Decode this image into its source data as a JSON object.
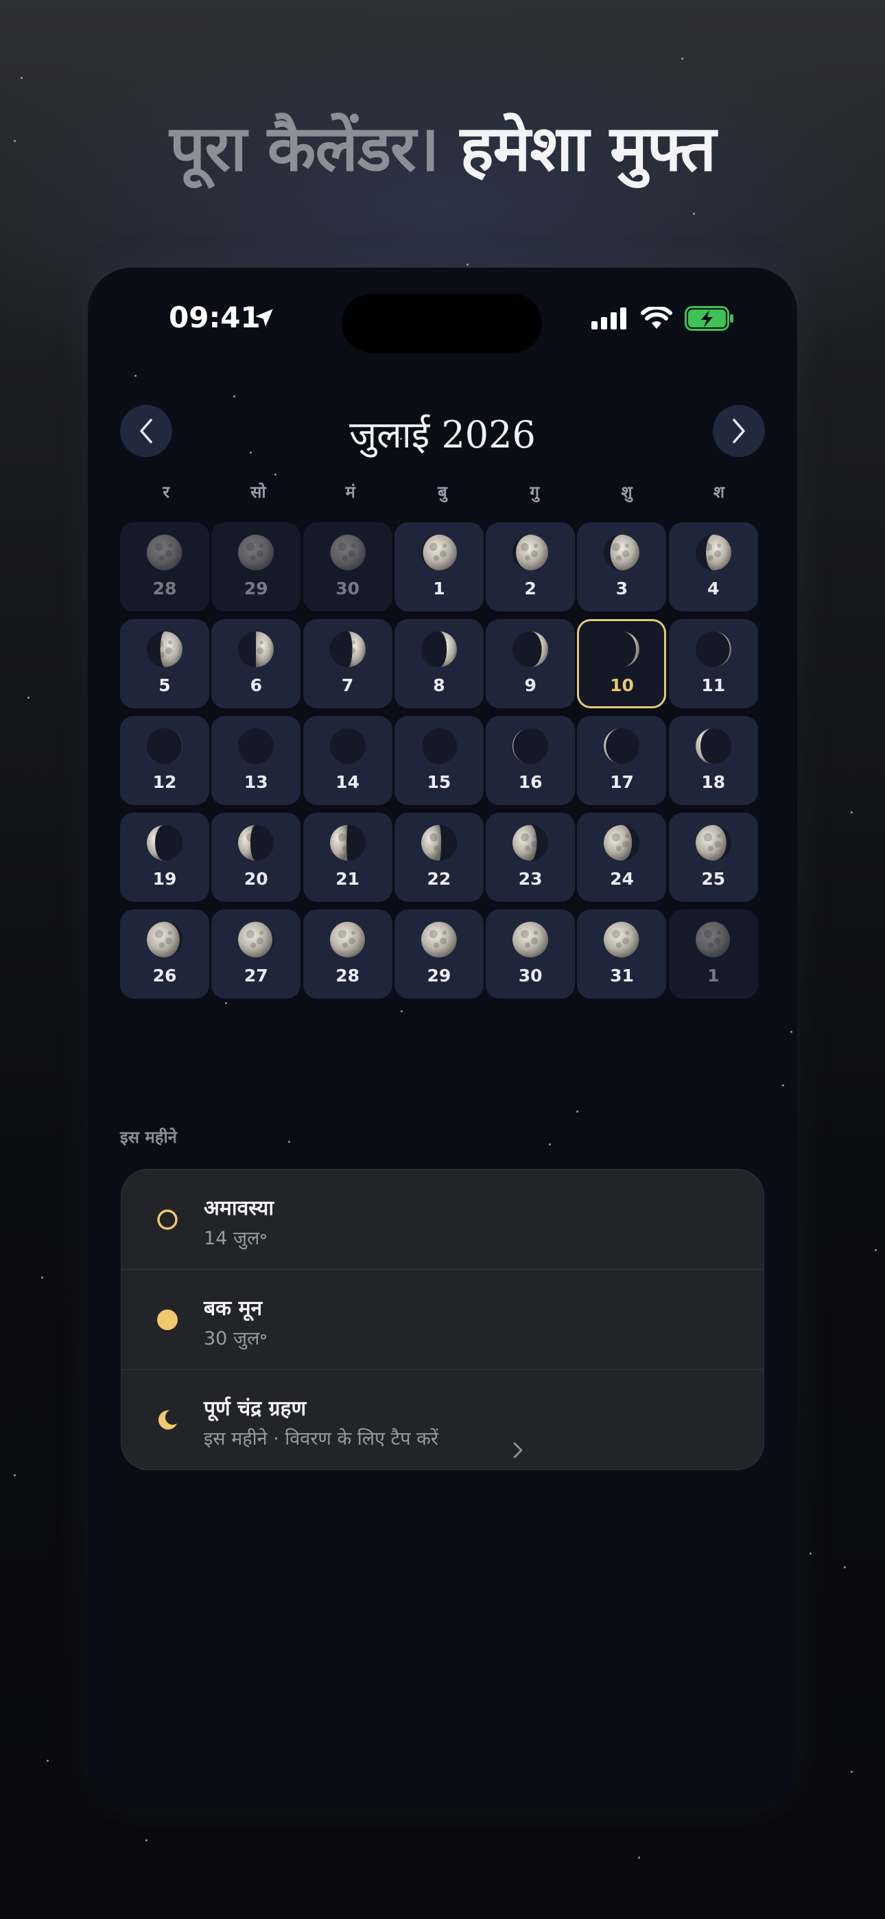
{
  "headline": {
    "part1": "पूरा कैलेंडर।",
    "part2": "हमेशा मुफ्त"
  },
  "status_bar": {
    "time": "09:41"
  },
  "calendar": {
    "month_title": "जुलाई 2026",
    "weekdays": [
      "र",
      "सो",
      "मं",
      "बु",
      "गु",
      "शु",
      "श"
    ],
    "days": [
      {
        "n": "28",
        "phase": 0.97,
        "muted": true
      },
      {
        "n": "29",
        "phase": 0.0,
        "muted": true
      },
      {
        "n": "30",
        "phase": 0.03,
        "muted": true
      },
      {
        "n": "1",
        "phase": 0.07
      },
      {
        "n": "2",
        "phase": 0.1
      },
      {
        "n": "3",
        "phase": 0.14
      },
      {
        "n": "4",
        "phase": 0.18
      },
      {
        "n": "5",
        "phase": 0.21
      },
      {
        "n": "6",
        "phase": 0.25
      },
      {
        "n": "7",
        "phase": 0.29
      },
      {
        "n": "8",
        "phase": 0.32
      },
      {
        "n": "9",
        "phase": 0.36
      },
      {
        "n": "10",
        "phase": 0.4,
        "today": true
      },
      {
        "n": "11",
        "phase": 0.43
      },
      {
        "n": "12",
        "phase": 0.47
      },
      {
        "n": "13",
        "phase": 0.49
      },
      {
        "n": "14",
        "phase": 0.5
      },
      {
        "n": "15",
        "phase": 0.52
      },
      {
        "n": "16",
        "phase": 0.55
      },
      {
        "n": "17",
        "phase": 0.58
      },
      {
        "n": "18",
        "phase": 0.62
      },
      {
        "n": "19",
        "phase": 0.66
      },
      {
        "n": "20",
        "phase": 0.7
      },
      {
        "n": "21",
        "phase": 0.74
      },
      {
        "n": "22",
        "phase": 0.77
      },
      {
        "n": "23",
        "phase": 0.81
      },
      {
        "n": "24",
        "phase": 0.85
      },
      {
        "n": "25",
        "phase": 0.88
      },
      {
        "n": "26",
        "phase": 0.91
      },
      {
        "n": "27",
        "phase": 0.94
      },
      {
        "n": "28",
        "phase": 0.96
      },
      {
        "n": "29",
        "phase": 0.98
      },
      {
        "n": "30",
        "phase": 1.0
      },
      {
        "n": "31",
        "phase": 0.97
      },
      {
        "n": "1",
        "phase": 0.94,
        "muted": true
      }
    ]
  },
  "events_section": {
    "label": "इस महीने",
    "items": [
      {
        "title": "अमावस्या",
        "subtitle": "14 जुल॰",
        "icon": "ring-icon"
      },
      {
        "title": "बक मून",
        "subtitle": "30 जुल॰",
        "icon": "full-moon-icon"
      },
      {
        "title": "पूर्ण चंद्र ग्रहण",
        "subtitle": "इस महीने · विवरण के लिए टैप करें",
        "icon": "crescent-icon"
      }
    ]
  },
  "colors": {
    "accent": "#e9c777",
    "background": "#0a0c16",
    "tile": "#1f253b",
    "card": "#232428"
  }
}
